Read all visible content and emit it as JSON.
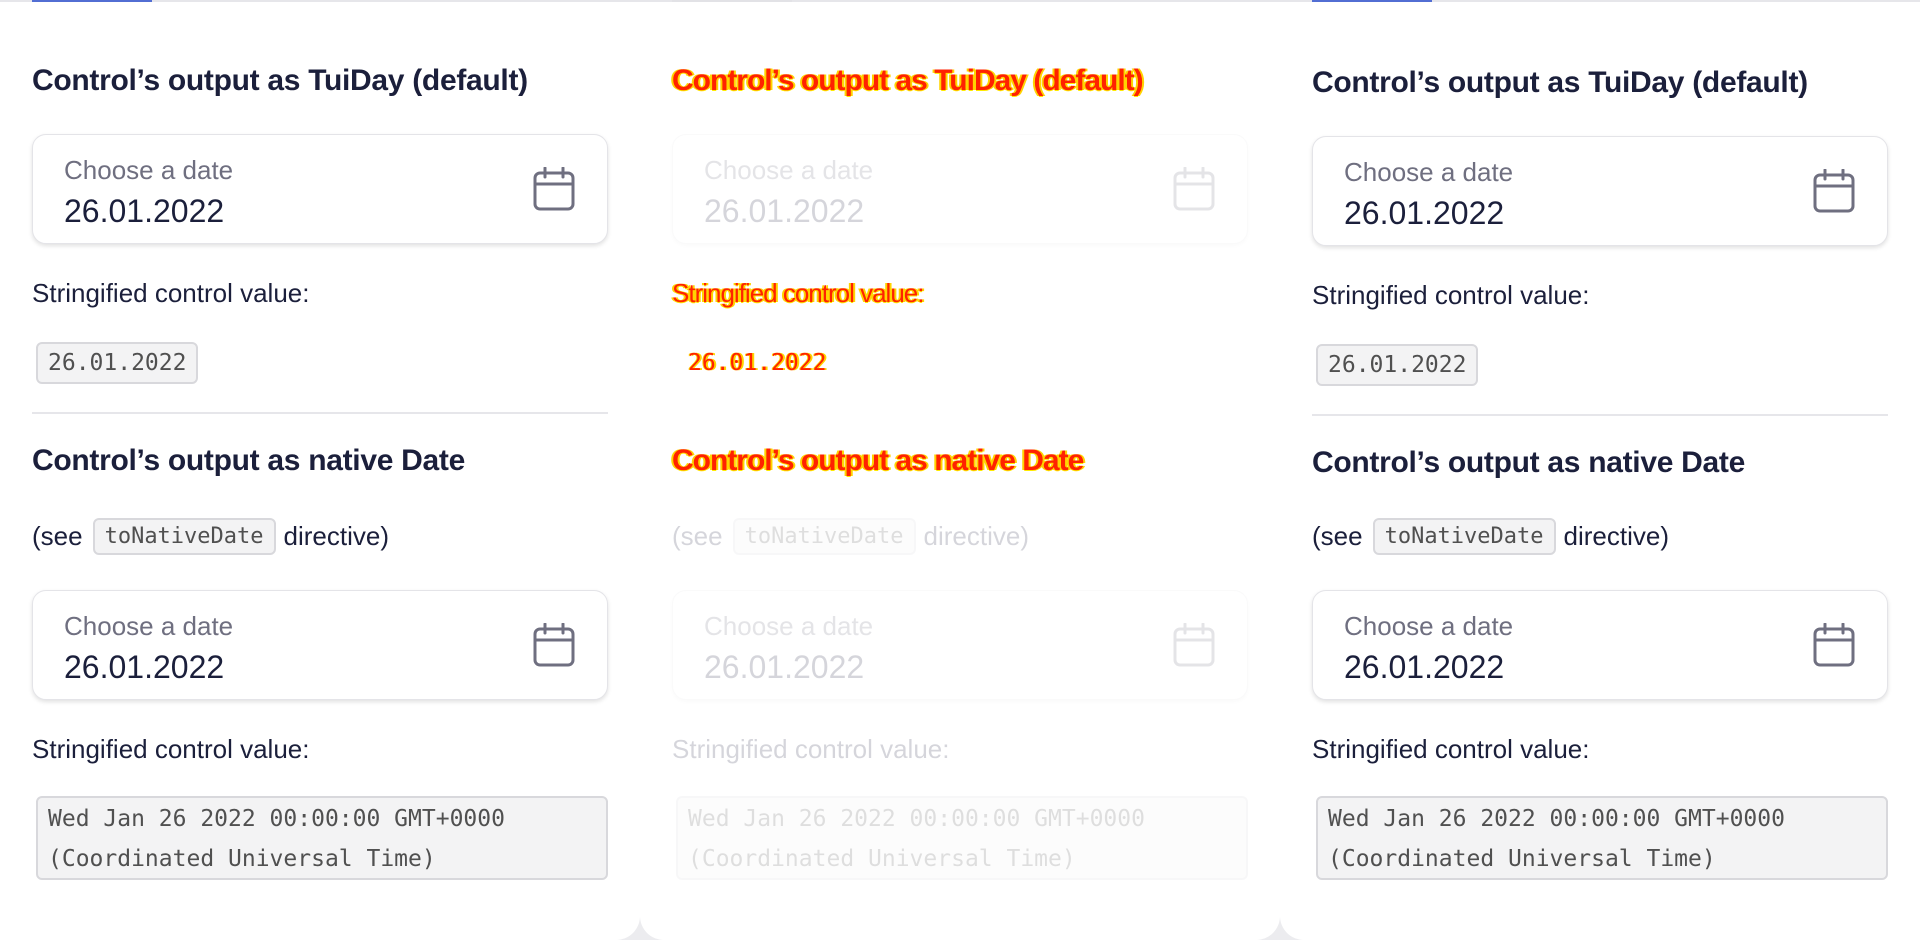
{
  "colors": {
    "accent": "#526ed3",
    "text": "#1b1f3b",
    "muted": "#6f6f80",
    "glitch_red": "#ff2200",
    "glitch_yellow": "#ffd400"
  },
  "panels": [
    {
      "id": "p1",
      "tuiday_heading": "Control’s output as TuiDay (default)",
      "date_label": "Choose a date",
      "date_value": "26.01.2022",
      "stringified_label": "Stringified control value:",
      "tuiday_code": "26.01.2022",
      "native_heading": "Control’s output as native Date",
      "see_prefix": "(see",
      "see_code": "toNativeDate",
      "see_suffix": "directive)",
      "native_date_label": "Choose a date",
      "native_date_value": "26.01.2022",
      "native_stringified_label": "Stringified control value:",
      "native_code": "Wed Jan 26 2022 00:00:00 GMT+0000 (Coordinated Universal Time)",
      "icon": "calendar-icon"
    },
    {
      "id": "p2",
      "tuiday_heading": "Control’s output as TuiDay (default)",
      "date_label": "Choose a date",
      "date_value": "26.01.2022",
      "stringified_label": "Stringified control value:",
      "tuiday_code": "26.01.2022",
      "native_heading": "Control’s output as native Date",
      "see_prefix": "(see",
      "see_code": "toNativeDate",
      "see_suffix": "directive)",
      "native_date_label": "Choose a date",
      "native_date_value": "26.01.2022",
      "native_stringified_label": "Stringified control value:",
      "native_code": "Wed Jan 26 2022 00:00:00 GMT+0000 (Coordinated Universal Time)",
      "icon": "calendar-icon"
    },
    {
      "id": "p3",
      "tuiday_heading": "Control’s output as TuiDay (default)",
      "date_label": "Choose a date",
      "date_value": "26.01.2022",
      "stringified_label": "Stringified control value:",
      "tuiday_code": "26.01.2022",
      "native_heading": "Control’s output as native Date",
      "see_prefix": "(see",
      "see_code": "toNativeDate",
      "see_suffix": "directive)",
      "native_date_label": "Choose a date",
      "native_date_value": "26.01.2022",
      "native_stringified_label": "Stringified control value:",
      "native_code": "Wed Jan 26 2022 00:00:00 GMT+0000 (Coordinated Universal Time)",
      "icon": "calendar-icon"
    }
  ]
}
